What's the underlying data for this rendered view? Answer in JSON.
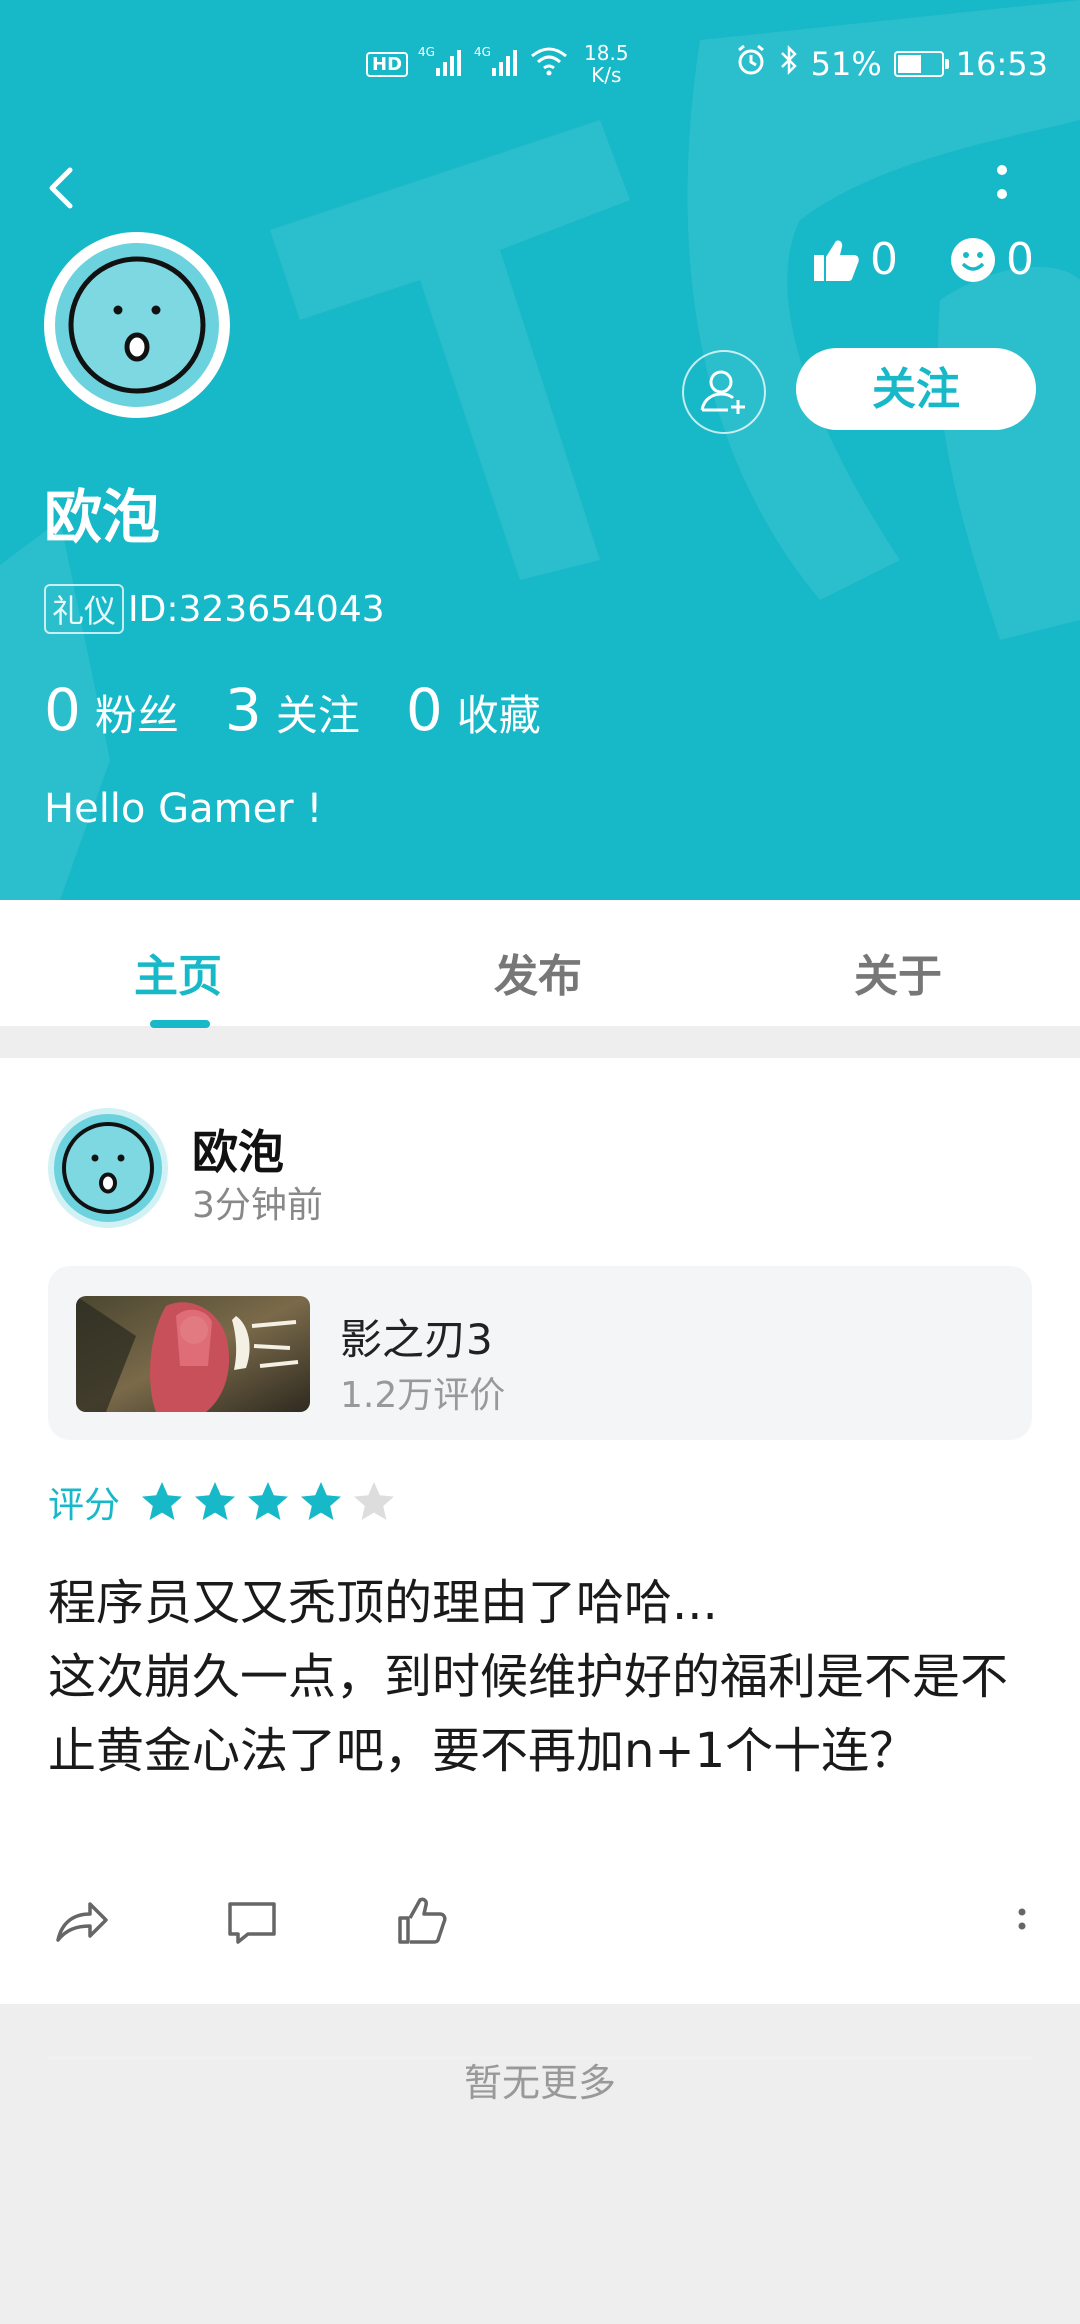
{
  "status_bar": {
    "hd": "HD",
    "net1": "4G",
    "net2": "4G",
    "speed_value": "18.5",
    "speed_unit": "K/s",
    "battery": "51%",
    "time": "16:53"
  },
  "profile": {
    "name": "欧泡",
    "badge": "礼仪",
    "id_text": "ID:323654043",
    "likes": "0",
    "smiles": "0",
    "follow_label": "关注",
    "bio": "Hello Gamer !",
    "counts": [
      {
        "num": "0",
        "label": "粉丝"
      },
      {
        "num": "3",
        "label": "关注"
      },
      {
        "num": "0",
        "label": "收藏"
      }
    ]
  },
  "tabs": [
    {
      "label": "主页",
      "active": true
    },
    {
      "label": "发布",
      "active": false
    },
    {
      "label": "关于",
      "active": false
    }
  ],
  "post": {
    "author": "欧泡",
    "time": "3分钟前",
    "game": {
      "title": "影之刃3",
      "reviews": "1.2万评价"
    },
    "rating_label": "评分",
    "rating": 4,
    "rating_max": 5,
    "text": "程序员又又秃顶的理由了哈哈...\n这次崩久一点，到时候维护好的福利是不是不止黄金心法了吧，要不再加n+1个十连？"
  },
  "footer": "暂无更多",
  "colors": {
    "accent": "#17b8c8",
    "star_off": "#dddddd"
  }
}
